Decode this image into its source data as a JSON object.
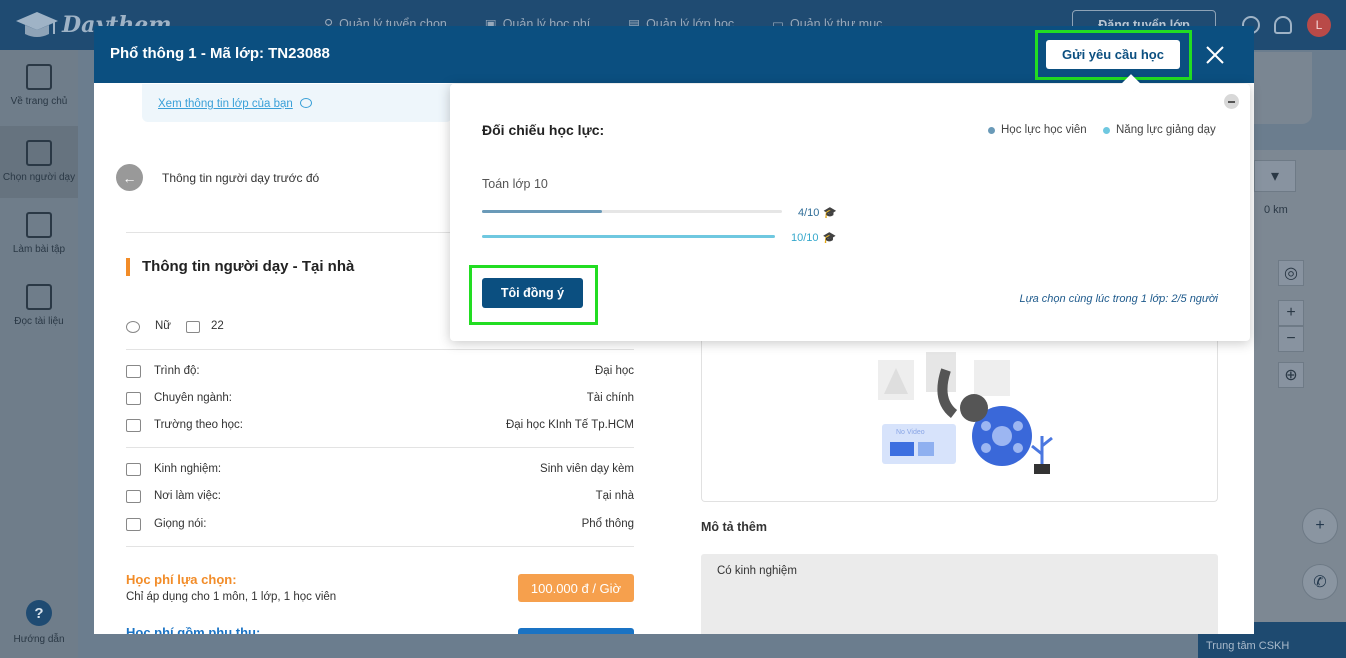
{
  "app": {
    "logo_text": "Daythem",
    "nav": [
      "Quản lý tuyển chọn",
      "Quản lý học phí",
      "Quản lý lớp học",
      "Quản lý thư mục"
    ],
    "register_button": "Đăng tuyển lớp",
    "avatar_initial": "L"
  },
  "sidebar": {
    "items": [
      {
        "label": "Về trang chủ"
      },
      {
        "label": "Chọn người dạy"
      },
      {
        "label": "Làm bài tập"
      },
      {
        "label": "Đọc tài liệu"
      }
    ],
    "help_label": "Hướng dẫn"
  },
  "map": {
    "distance": "0 km",
    "zoom_in": "+",
    "zoom_out": "−",
    "cskh_label": "Trung tâm CSKH"
  },
  "modal": {
    "title": "Phổ thông 1 - Mã lớp: TN23088",
    "send_request_button": "Gửi yêu cầu học",
    "view_class_link": "Xem thông tin lớp của bạn",
    "prev_teacher": "Thông tin người dạy trước đó",
    "section_title": "Thông tin người dạy - Tại nhà",
    "gender": "Nữ",
    "age": "22",
    "rows_edu": [
      {
        "label": "Trình độ:",
        "value": "Đại học"
      },
      {
        "label": "Chuyên ngành:",
        "value": "Tài chính"
      },
      {
        "label": "Trường theo học:",
        "value": "Đại học KInh Tế Tp.HCM"
      }
    ],
    "rows_work": [
      {
        "label": "Kinh nghiệm:",
        "value": "Sinh viên dạy kèm"
      },
      {
        "label": "Nơi làm việc:",
        "value": "Tại nhà"
      },
      {
        "label": "Giọng nói:",
        "value": "Phổ thông"
      }
    ],
    "fee_title": "Học phí lựa chọn:",
    "fee_sub": "Chỉ áp dụng cho 1 môn, 1 lớp, 1 học viên",
    "fee_value": "100.000 đ / Giờ",
    "fee2_title": "Học phí gồm phụ thu:",
    "video_placeholder": "No Video",
    "desc_title": "Mô tả thêm",
    "desc_text": "Có kinh nghiệm"
  },
  "popover": {
    "title": "Đối chiếu học lực:",
    "legend": [
      {
        "label": "Học lực học viên",
        "color": "#6a9ab8"
      },
      {
        "label": "Năng lực giảng dạy",
        "color": "#6fc8e0"
      }
    ],
    "subject": "Toán lớp 10",
    "student_score": "4/10",
    "student_fraction": 0.4,
    "teacher_score": "10/10",
    "teacher_fraction": 1.0,
    "agree_button": "Tôi đồng ý",
    "note": "Lựa chọn cùng lúc trong 1 lớp: 2/5 người"
  }
}
